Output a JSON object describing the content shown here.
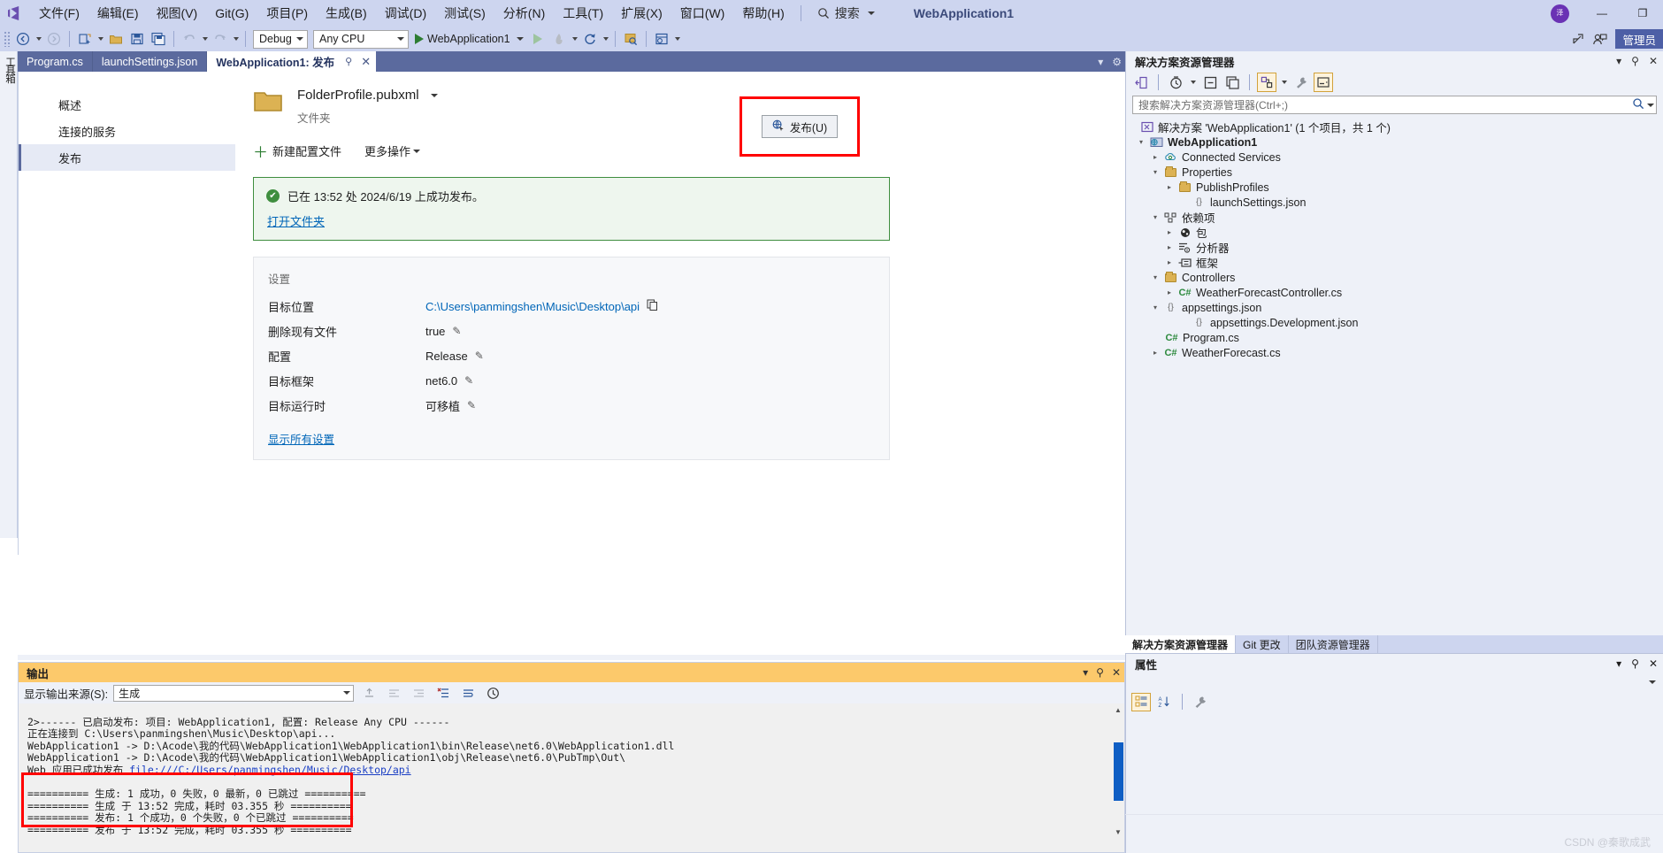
{
  "titlebar": {
    "logo_icon": "visual-studio-logo",
    "menus": [
      {
        "label": "文件(F)"
      },
      {
        "label": "编辑(E)"
      },
      {
        "label": "视图(V)"
      },
      {
        "label": "Git(G)"
      },
      {
        "label": "项目(P)"
      },
      {
        "label": "生成(B)"
      },
      {
        "label": "调试(D)"
      },
      {
        "label": "测试(S)"
      },
      {
        "label": "分析(N)"
      },
      {
        "label": "工具(T)"
      },
      {
        "label": "扩展(X)"
      },
      {
        "label": "窗口(W)"
      },
      {
        "label": "帮助(H)"
      }
    ],
    "search_label": "搜索",
    "solution_name": "WebApplication1",
    "avatar_initials": "泽",
    "minimize_label": "—",
    "restore_label": "❐"
  },
  "toolbar": {
    "back_icon": "navigate-back-icon",
    "forward_icon": "navigate-forward-icon",
    "new_project_icon": "new-project-icon",
    "open_icon": "open-folder-icon",
    "save_icon": "save-icon",
    "save_all_icon": "save-all-icon",
    "undo_icon": "undo-icon",
    "redo_icon": "redo-icon",
    "configuration": "Debug",
    "platform": "Any CPU",
    "start_label": "WebApplication1",
    "start_icon": "play-icon",
    "start_no_debug_icon": "play-outline-icon",
    "hot_reload_icon": "hot-reload-icon",
    "refresh_icon": "refresh-icon",
    "select_element_icon": "select-element-icon",
    "layout_icon": "layout-icon",
    "share_icon": "share-icon",
    "feedback_icon": "feedback-icon",
    "manage_label": "管理员"
  },
  "left_dock": {
    "toolbox_label": "工具箱"
  },
  "doc_tabs": [
    {
      "label": "Program.cs",
      "active": false
    },
    {
      "label": "launchSettings.json",
      "active": false
    },
    {
      "label": "WebApplication1: 发布",
      "active": true,
      "pin_icon": "pin-icon",
      "close_icon": "close-icon"
    }
  ],
  "tab_controls": {
    "dropdown_icon": "chevron-down-icon",
    "settings_icon": "gear-icon"
  },
  "publish": {
    "nav": [
      {
        "label": "概述",
        "active": false
      },
      {
        "label": "连接的服务",
        "active": false
      },
      {
        "label": "发布",
        "active": true
      }
    ],
    "profile_icon": "folder-icon",
    "profile_name": "FolderProfile.pubxml",
    "profile_dropdown_icon": "chevron-down-icon",
    "profile_type": "文件夹",
    "publish_button": {
      "label": "发布(U)",
      "icon": "publish-icon"
    },
    "actions": [
      {
        "label": "新建配置文件",
        "icon": "plus-icon"
      },
      {
        "label": "更多操作",
        "icon": "chevron-down-icon"
      }
    ],
    "success": {
      "icon": "check-circle-icon",
      "message": "已在 13:52 处 2024/6/19 上成功发布。",
      "link": "打开文件夹"
    },
    "settings": {
      "title": "设置",
      "rows": [
        {
          "key": "目标位置",
          "value": "C:\\Users\\panmingshen\\Music\\Desktop\\api",
          "kind": "link",
          "action_icon": "copy-icon"
        },
        {
          "key": "删除现有文件",
          "value": "true",
          "kind": "text",
          "action_icon": "pencil-icon"
        },
        {
          "key": "配置",
          "value": "Release",
          "kind": "text",
          "action_icon": "pencil-icon"
        },
        {
          "key": "目标框架",
          "value": "net6.0",
          "kind": "text",
          "action_icon": "pencil-icon"
        },
        {
          "key": "目标运行时",
          "value": "可移植",
          "kind": "text",
          "action_icon": "pencil-icon"
        }
      ],
      "show_all": "显示所有设置"
    }
  },
  "output": {
    "title": "输出",
    "minimize_icon": "chevron-down-icon",
    "pin_icon": "pin-icon",
    "close_icon": "close-icon",
    "source_label": "显示输出来源(S):",
    "source_value": "生成",
    "toolbar_icons": [
      "find-message-icon",
      "go-to-previous-icon",
      "go-to-next-icon",
      "clear-all-icon",
      "word-wrap-icon",
      "toggle-timestamp-icon"
    ],
    "lines": [
      "2>------ 已启动发布: 项目: WebApplication1, 配置: Release Any CPU ------",
      "正在连接到 C:\\Users\\panmingshen\\Music\\Desktop\\api...",
      "WebApplication1 -> D:\\Acode\\我的代码\\WebApplication1\\WebApplication1\\bin\\Release\\net6.0\\WebApplication1.dll",
      "WebApplication1 -> D:\\Acode\\我的代码\\WebApplication1\\WebApplication1\\obj\\Release\\net6.0\\PubTmp\\Out\\"
    ],
    "link_line_prefix": "Web 应用已成功发布 ",
    "link_line_url": "file:///C:/Users/panmingshen/Music/Desktop/api",
    "summary_lines": [
      "========== 生成: 1 成功，0 失败，0 最新，0 已跳过 ==========",
      "========== 生成 于 13:52 完成，耗时 03.355 秒 ==========",
      "========== 发布: 1 个成功，0 个失败，0 个已跳过 ==========",
      "========== 发布 于 13:52 完成，耗时 03.355 秒 =========="
    ]
  },
  "solution_explorer": {
    "title": "解决方案资源管理器",
    "dropdown_icon": "chevron-down-icon",
    "pin_icon": "pin-icon",
    "close_icon": "close-icon",
    "toolbar_icons": [
      "back-to-code-icon",
      "pending-changes-icon",
      "collapse-all-icon",
      "view-all-files-icon",
      "show-all-files-icon",
      "properties-icon",
      "preview-selected-icon"
    ],
    "search_placeholder": "搜索解决方案资源管理器(Ctrl+;)",
    "search_icon": "search-icon",
    "search_dropdown_icon": "chevron-down-icon",
    "tree": [
      {
        "label": "解决方案 'WebApplication1' (1 个项目，共 1 个)",
        "indent": 0,
        "arrow": "",
        "icon": "solution-icon",
        "bold": false
      },
      {
        "label": "WebApplication1",
        "indent": 1,
        "arrow": "▲",
        "icon": "web-project-icon",
        "bold": true
      },
      {
        "label": "Connected Services",
        "indent": 2,
        "arrow": "▶",
        "icon": "connected-services-icon",
        "bold": false
      },
      {
        "label": "Properties",
        "indent": 2,
        "arrow": "▲",
        "icon": "properties-folder-icon",
        "bold": false
      },
      {
        "label": "PublishProfiles",
        "indent": 3,
        "arrow": "▶",
        "icon": "folder-icon",
        "bold": false
      },
      {
        "label": "launchSettings.json",
        "indent": 4,
        "arrow": "",
        "icon": "json-icon",
        "bold": false
      },
      {
        "label": "依赖项",
        "indent": 2,
        "arrow": "▲",
        "icon": "dependencies-icon",
        "bold": false
      },
      {
        "label": "包",
        "indent": 3,
        "arrow": "▶",
        "icon": "package-icon",
        "bold": false
      },
      {
        "label": "分析器",
        "indent": 3,
        "arrow": "▶",
        "icon": "analyzer-icon",
        "bold": false
      },
      {
        "label": "框架",
        "indent": 3,
        "arrow": "▶",
        "icon": "framework-icon",
        "bold": false
      },
      {
        "label": "Controllers",
        "indent": 2,
        "arrow": "▲",
        "icon": "folder-icon",
        "bold": false
      },
      {
        "label": "WeatherForecastController.cs",
        "indent": 3,
        "arrow": "▶",
        "icon": "csharp-icon",
        "bold": false
      },
      {
        "label": "appsettings.json",
        "indent": 2,
        "arrow": "▲",
        "icon": "json-icon",
        "bold": false
      },
      {
        "label": "appsettings.Development.json",
        "indent": 3,
        "arrow": "",
        "icon": "json-icon",
        "bold": false
      },
      {
        "label": "Program.cs",
        "indent": 2,
        "arrow": "",
        "icon": "csharp-icon",
        "bold": false
      },
      {
        "label": "WeatherForecast.cs",
        "indent": 2,
        "arrow": "▶",
        "icon": "csharp-icon",
        "bold": false
      }
    ]
  },
  "panel_tabs": [
    {
      "label": "解决方案资源管理器",
      "active": true
    },
    {
      "label": "Git 更改",
      "active": false
    },
    {
      "label": "团队资源管理器",
      "active": false
    }
  ],
  "properties": {
    "title": "属性",
    "dropdown_icon": "chevron-down-icon",
    "pin_icon": "pin-icon",
    "close_icon": "close-icon",
    "object_selector_icon": "chevron-down-icon",
    "toolbar_icons": [
      "categorized-icon",
      "alphabetical-icon",
      "property-pages-icon"
    ]
  },
  "watermark": "CSDN @秦歌成武",
  "colors": {
    "chrome": "#cdd5ef",
    "tab_strip": "#5b6a9e",
    "accent_link": "#0066b8",
    "success_border": "#3f8e3f",
    "highlight_red": "#ff0000",
    "output_header": "#fcc96b"
  }
}
